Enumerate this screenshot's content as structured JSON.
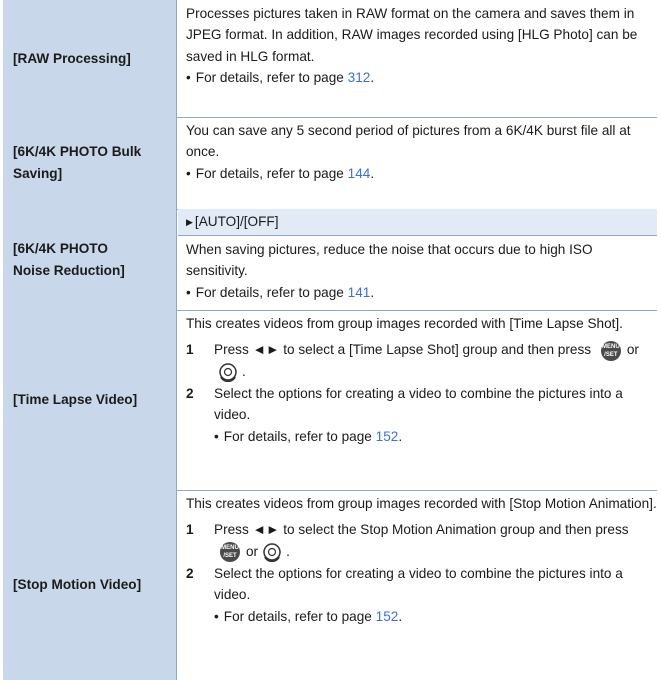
{
  "rows": [
    {
      "label": "[RAW Processing]",
      "desc": "Processes pictures taken in RAW format on the camera and saves them in JPEG format. In addition, RAW images recorded using [HLG Photo] can be saved in HLG format.",
      "ref_text": "For details, refer to page ",
      "ref_page": "312"
    },
    {
      "label_line1": "[6K/4K PHOTO Bulk",
      "label_line2": "Saving]",
      "desc": "You can save any 5 second period of pictures from a 6K/4K burst file all at once.",
      "ref_text": "For details, refer to page ",
      "ref_page": "144"
    },
    {
      "label_line1": "[6K/4K PHOTO",
      "label_line2": "Noise Reduction]",
      "option": "[AUTO]/[OFF]",
      "desc": "When saving pictures, reduce the noise that occurs due to high ISO sensitivity.",
      "ref_text": "For details, refer to page ",
      "ref_page": "141"
    },
    {
      "label": "[Time Lapse Video]",
      "desc": "This creates videos from group images recorded with [Time Lapse Shot].",
      "step1_num": "1",
      "step1_a": "Press",
      "step1_arrows": "◄►",
      "step1_b": "to select a [Time Lapse Shot] group and then press",
      "step1_or": "or",
      "step2_num": "2",
      "step2": "Select the options for creating a video to combine the pictures into a video.",
      "ref_text": "For details, refer to page ",
      "ref_page": "152"
    },
    {
      "label": "[Stop Motion Video]",
      "desc": "This creates videos from group images recorded with [Stop Motion Animation].",
      "step1_num": "1",
      "step1_a": "Press",
      "step1_arrows": "◄►",
      "step1_b": "to select the Stop Motion Animation group and then press",
      "step1_or": "or",
      "step2_num": "2",
      "step2": "Select the options for creating a video to combine the pictures into a video.",
      "ref_text": "For details, refer to page ",
      "ref_page": "152"
    }
  ],
  "icons": {
    "menu_set_line1": "MENU",
    "menu_set_line2": "/SET"
  },
  "colors": {
    "label_bg": "#c8d7ea",
    "option_bg": "#e2eaf6",
    "link": "#3f6fd1",
    "border": "#8fa8c8"
  }
}
